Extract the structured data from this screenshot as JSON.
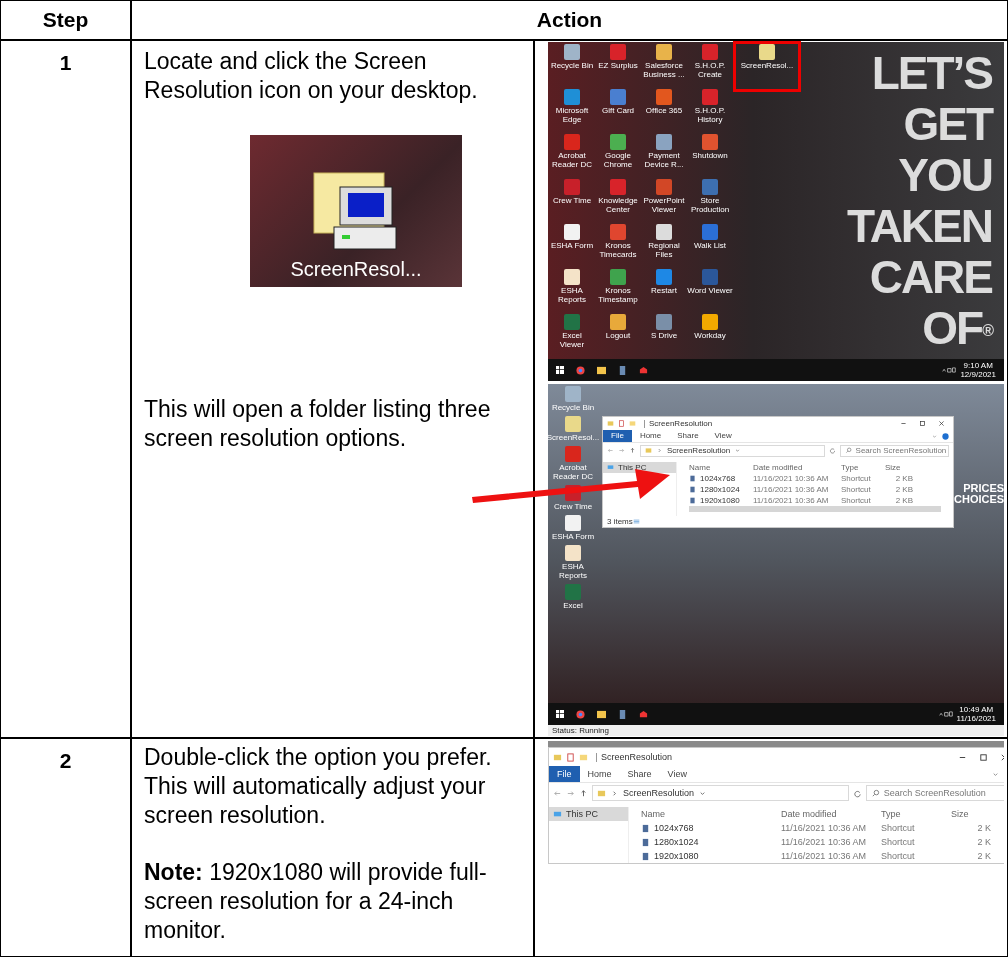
{
  "table": {
    "columns": [
      "Step",
      "Action"
    ],
    "rows": [
      {
        "step": "1",
        "instruction": "Locate and click the Screen Resolution icon on your desktop.",
        "icon_closeup": {
          "label": "ScreenResol..."
        },
        "followup": "This will open a folder listing three screen resolution options.",
        "desktop": {
          "icon_rows": [
            [
              {
                "label": "Recycle Bin",
                "color": "#9fb4c8",
                "marked": false
              },
              {
                "label": "EZ Surplus",
                "color": "#d8232a",
                "marked": false
              },
              {
                "label": "Salesforce Business ...",
                "color": "#e8b34a",
                "marked": false
              },
              {
                "label": "S.H.O.P. Create",
                "color": "#d8232a",
                "marked": false
              },
              {
                "label": "ScreenResol...",
                "color": "#e9d98a",
                "marked": true
              }
            ],
            [
              {
                "label": "Microsoft Edge",
                "color": "#1f8fd6",
                "marked": false
              },
              {
                "label": "Gift Card",
                "color": "#4a7fd0",
                "marked": false
              },
              {
                "label": "Office 365",
                "color": "#e2571e",
                "marked": false
              },
              {
                "label": "S.H.O.P. History",
                "color": "#d8232a",
                "marked": false
              }
            ],
            [
              {
                "label": "Acrobat Reader DC",
                "color": "#d9261c",
                "marked": false
              },
              {
                "label": "Google Chrome",
                "color": "#4caf50",
                "marked": false
              },
              {
                "label": "Payment Device R...",
                "color": "#8aa3c0",
                "marked": false
              },
              {
                "label": "Shutdown",
                "color": "#e0532f",
                "marked": false
              }
            ],
            [
              {
                "label": "Crew Time",
                "color": "#c8202a",
                "marked": false
              },
              {
                "label": "Knowledge Center",
                "color": "#d8232a",
                "marked": false
              },
              {
                "label": "PowerPoint Viewer",
                "color": "#d24726",
                "marked": false
              },
              {
                "label": "Store Production",
                "color": "#3d6fb0",
                "marked": false
              }
            ],
            [
              {
                "label": "ESHA Form",
                "color": "#f2f2f2",
                "marked": false
              },
              {
                "label": "Kronos Timecards",
                "color": "#e0462f",
                "marked": false
              },
              {
                "label": "Regional Files",
                "color": "#dcdcdc",
                "marked": false
              },
              {
                "label": "Walk List",
                "color": "#2b6fd6",
                "marked": false
              }
            ],
            [
              {
                "label": "ESHA Reports",
                "color": "#f4e3c8",
                "marked": false
              },
              {
                "label": "Kronos Timestamp",
                "color": "#3fa34d",
                "marked": false
              },
              {
                "label": "Restart",
                "color": "#1e88e5",
                "marked": false
              },
              {
                "label": "Word Viewer",
                "color": "#2b579a",
                "marked": false
              }
            ],
            [
              {
                "label": "Excel Viewer",
                "color": "#217346",
                "marked": false
              },
              {
                "label": "Logout",
                "color": "#e8a93a",
                "marked": false
              },
              {
                "label": "S Drive",
                "color": "#7a8fa8",
                "marked": false
              },
              {
                "label": "Workday",
                "color": "#f2a900",
                "marked": false
              }
            ]
          ],
          "wallpaper_text": [
            "LET’S",
            "GET",
            "YOU",
            "TAKEN",
            "CARE",
            "OF$^{®}$"
          ],
          "clock": {
            "time": "9:10 AM",
            "date": "12/9/2021"
          }
        },
        "desktop_2": {
          "icons": [
            {
              "label": "Recycle Bin",
              "color": "#9fb4c8"
            },
            {
              "label": "ScreenResol...",
              "color": "#e9d98a"
            },
            {
              "label": "Acrobat Reader DC",
              "color": "#d9261c"
            },
            {
              "label": "Crew Time",
              "color": "#c8202a"
            },
            {
              "label": "ESHA Form",
              "color": "#f2f2f2"
            },
            {
              "label": "ESHA Reports",
              "color": "#f4e3c8"
            },
            {
              "label": "Excel",
              "color": "#217346"
            }
          ],
          "wallpaper_text": [
            "PRICES",
            "CHOICES"
          ],
          "explorer": {
            "title": "ScreenResolution",
            "ribbon_tabs": [
              {
                "label": "File",
                "selected": true
              },
              {
                "label": "Home",
                "selected": false
              },
              {
                "label": "Share",
                "selected": false
              },
              {
                "label": "View",
                "selected": false
              }
            ],
            "address": "ScreenResolution",
            "search_placeholder": "Search ScreenResolution",
            "nav_items": [
              {
                "label": "This PC",
                "selected": true
              }
            ],
            "columns": [
              "Name",
              "Date modified",
              "Type",
              "Size"
            ],
            "files": [
              {
                "name": "1024x768",
                "date": "11/16/2021 10:36 AM",
                "type": "Shortcut",
                "size": "2 KB"
              },
              {
                "name": "1280x1024",
                "date": "11/16/2021 10:36 AM",
                "type": "Shortcut",
                "size": "2 KB"
              },
              {
                "name": "1920x1080",
                "date": "11/16/2021 10:36 AM",
                "type": "Shortcut",
                "size": "2 KB"
              }
            ],
            "status": "3 items"
          },
          "clock": {
            "time": "10:49 AM",
            "date": "11/16/2021"
          },
          "status": "Status: Running"
        }
      },
      {
        "step": "2",
        "instruction": "Double-click the option you prefer. This will automatically adjust your screen resolution.",
        "note": "**Note:** 1920x1080 will provide full-screen resolution for a 24-inch monitor.",
        "explorer": {
          "title": "ScreenResolution",
          "ribbon_tabs": [
            {
              "label": "File",
              "selected": true
            },
            {
              "label": "Home",
              "selected": false
            },
            {
              "label": "Share",
              "selected": false
            },
            {
              "label": "View",
              "selected": false
            }
          ],
          "address": "ScreenResolution",
          "search_placeholder": "Search ScreenResolution",
          "nav_items": [
            {
              "label": "This PC",
              "selected": true
            }
          ],
          "columns": [
            "Name",
            "Date modified",
            "Type",
            "Size"
          ],
          "files": [
            {
              "name": "1024x768",
              "date": "11/16/2021 10:36 AM",
              "type": "Shortcut",
              "size": "2 K"
            },
            {
              "name": "1280x1024",
              "date": "11/16/2021 10:36 AM",
              "type": "Shortcut",
              "size": "2 K"
            },
            {
              "name": "1920x1080",
              "date": "11/16/2021 10:36 AM",
              "type": "Shortcut",
              "size": "2 K"
            }
          ]
        }
      }
    ]
  }
}
